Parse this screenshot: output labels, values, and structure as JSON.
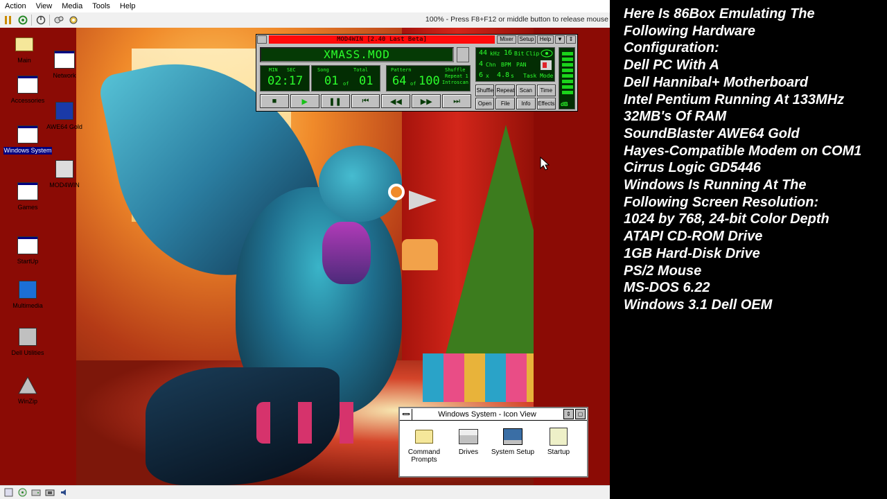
{
  "host": {
    "menu": [
      "Action",
      "View",
      "Media",
      "Tools",
      "Help"
    ],
    "toolbar_message": "100% - Press F8+F12 or middle button to release mouse"
  },
  "desktop": {
    "icons": [
      {
        "label": "Main",
        "selected": false
      },
      {
        "label": "Accessories",
        "selected": false
      },
      {
        "label": "Windows System",
        "selected": true
      },
      {
        "label": "Games",
        "selected": false
      },
      {
        "label": "StartUp",
        "selected": false
      },
      {
        "label": "Multimedia",
        "selected": false
      },
      {
        "label": "Dell Utilities",
        "selected": false
      },
      {
        "label": "WinZip",
        "selected": false
      },
      {
        "label": "Network",
        "selected": false
      },
      {
        "label": "AWE64 Gold",
        "selected": false
      },
      {
        "label": "MOD4WIN",
        "selected": false
      }
    ]
  },
  "mod4win": {
    "title": "MOD4WIN [2.40 Last Beta]",
    "buttons": {
      "mixer": "Mixer",
      "setup": "Setup",
      "help": "Help"
    },
    "song_display": "XMASS.MOD",
    "time": {
      "min_label": "MIN",
      "sec_label": "SEC",
      "value": "02:17"
    },
    "song": {
      "label": "Song",
      "current": "01",
      "of": "of",
      "total_label": "Total",
      "total": "01"
    },
    "pattern": {
      "label": "Pattern",
      "current": "64",
      "of": "of",
      "total": "100",
      "flags": [
        "Shuffle",
        "Repeat 1",
        "Introscan"
      ]
    },
    "info": {
      "khz": "44",
      "khz_unit": "kHz",
      "bits": "16",
      "bits_unit": "Bit",
      "clip": "Clip",
      "chn": "4",
      "chn_unit": "Chn",
      "bpm": "BPM",
      "pan": "PAN",
      "speed": "6",
      "speed_unit": "x",
      "rate": "4.8",
      "rate_unit": "s",
      "task_mode": "Task Mode"
    },
    "meter_label": "dB",
    "transport": [
      "■",
      "▶",
      "❚❚",
      "⏮",
      "◀◀",
      "▶▶",
      "⏭"
    ],
    "grid_buttons": [
      "Shuffle",
      "Repeat",
      "Scan",
      "Time",
      "Open",
      "File",
      "Info",
      "Effects"
    ]
  },
  "program_group": {
    "title": "Windows System - Icon View",
    "items": [
      {
        "label": "Command Prompts"
      },
      {
        "label": "Drives"
      },
      {
        "label": "System Setup"
      },
      {
        "label": "Startup"
      }
    ]
  },
  "overlay_lines": [
    "Here Is 86Box Emulating The",
    "Following Hardware",
    "Configuration:",
    "Dell PC With A",
    "Dell Hannibal+ Motherboard",
    "Intel Pentium Running At 133MHz",
    "32MB's Of RAM",
    "SoundBlaster AWE64 Gold",
    "Hayes-Compatible Modem on COM1",
    "Cirrus Logic GD5446",
    "Windows Is Running At The",
    "Following Screen Resolution:",
    "1024 by 768, 24-bit Color Depth",
    "ATAPI CD-ROM Drive",
    "1GB Hard-Disk Drive",
    "PS/2 Mouse",
    "MS-DOS 6.22",
    "Windows 3.1 Dell OEM"
  ]
}
